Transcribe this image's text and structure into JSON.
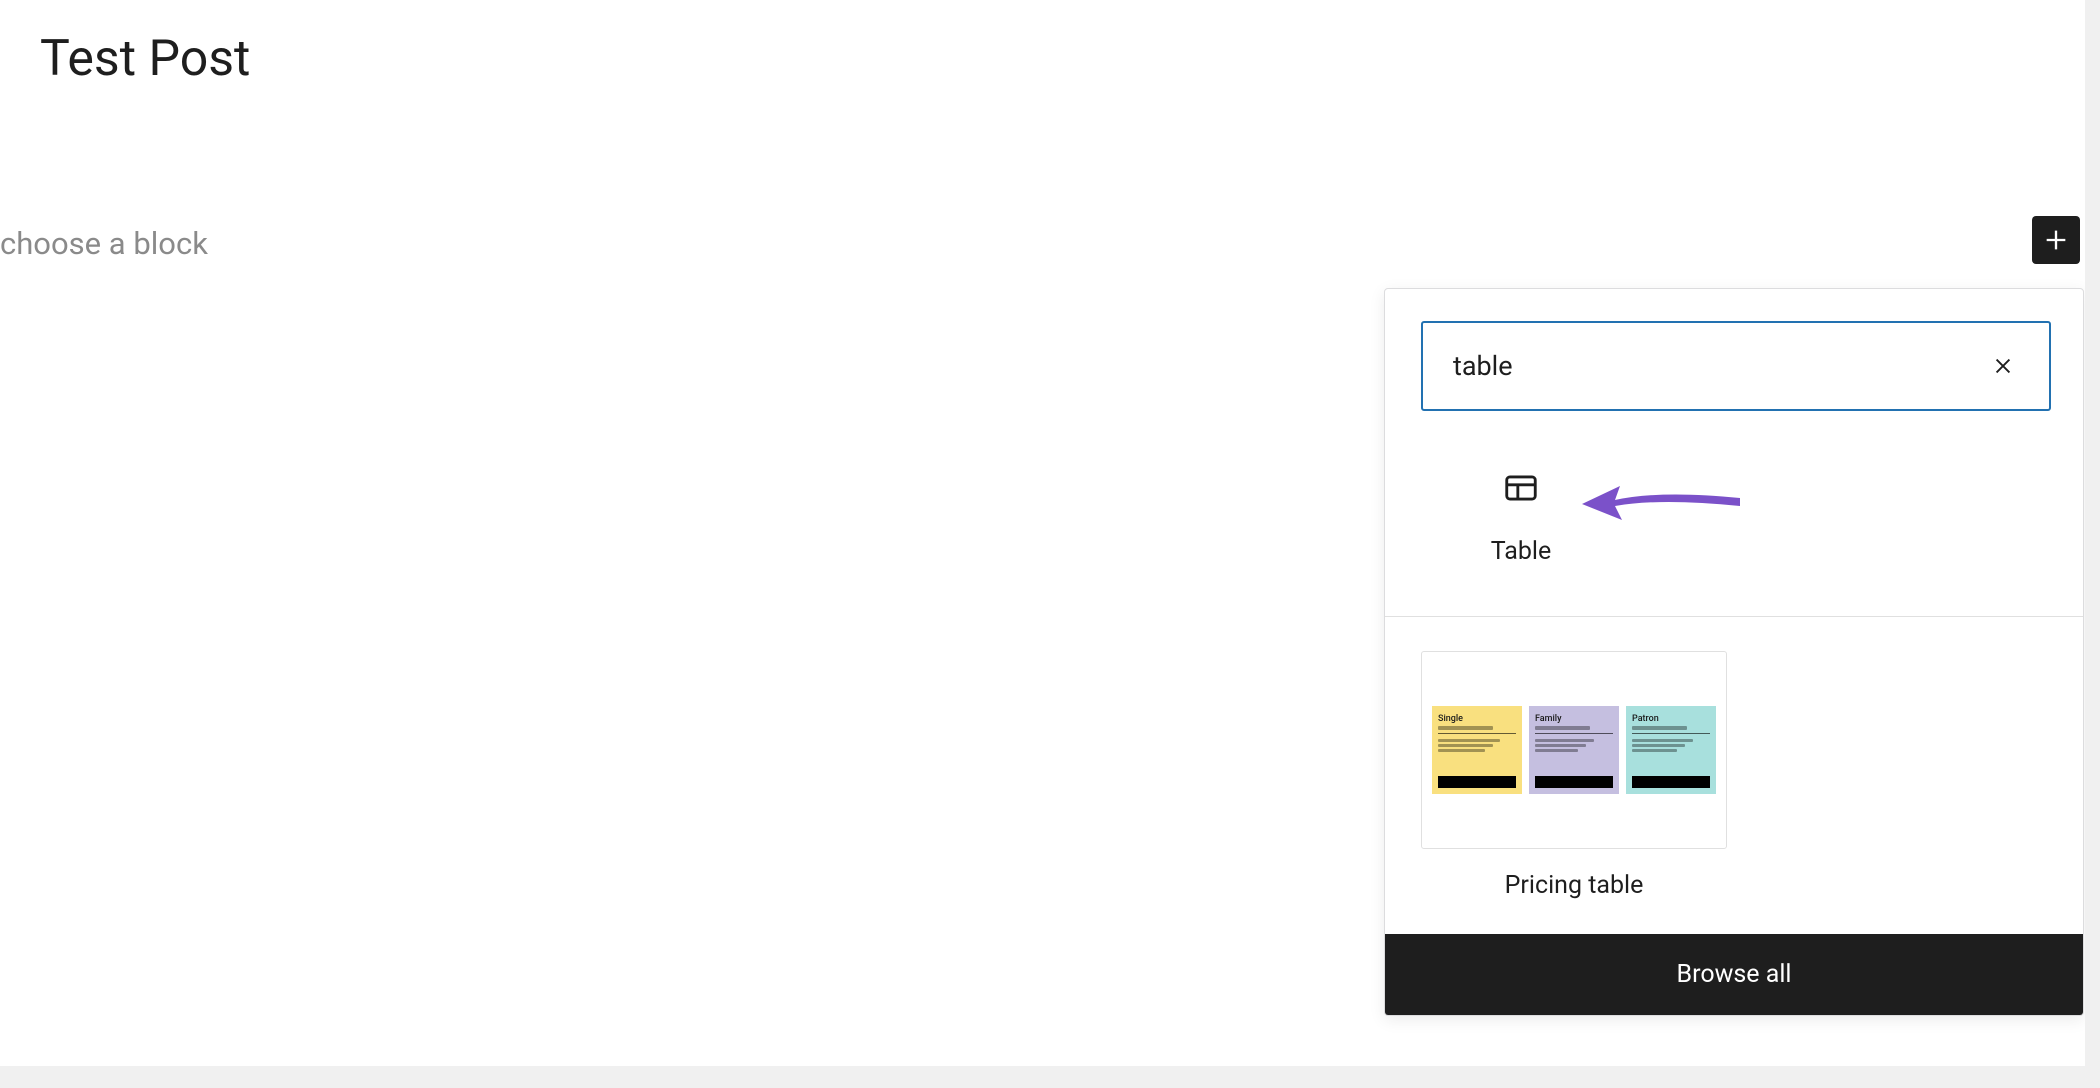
{
  "post": {
    "title": "Test Post",
    "placeholder": "choose a block"
  },
  "inserter": {
    "search_value": "table",
    "blocks": [
      {
        "label": "Table"
      }
    ],
    "patterns": [
      {
        "label": "Pricing table",
        "tiers": [
          {
            "name": "Single",
            "color": "yellow"
          },
          {
            "name": "Family",
            "color": "purple"
          },
          {
            "name": "Patron",
            "color": "teal"
          }
        ]
      }
    ],
    "browse_all_label": "Browse all"
  },
  "annotation": {
    "arrow_color": "#7b51c9"
  }
}
